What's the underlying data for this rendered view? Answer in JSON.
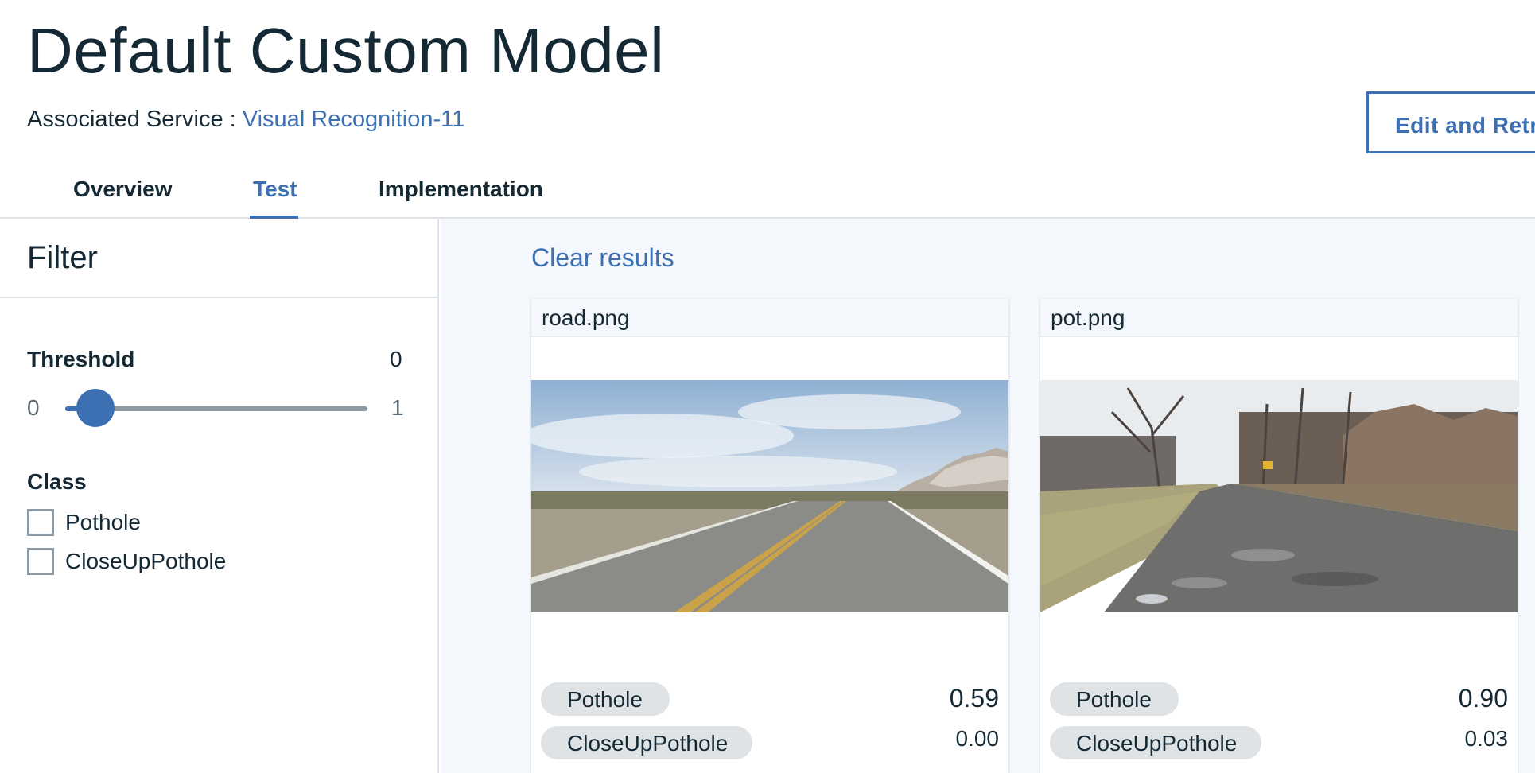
{
  "header": {
    "title": "Default Custom Model",
    "associated_label": "Associated Service : ",
    "associated_link": "Visual Recognition-11",
    "edit_button": "Edit and Retrain"
  },
  "tabs": [
    {
      "label": "Overview",
      "active": false
    },
    {
      "label": "Test",
      "active": true
    },
    {
      "label": "Implementation",
      "active": false
    }
  ],
  "filter": {
    "title": "Filter",
    "threshold_label": "Threshold",
    "threshold_value": "0",
    "slider_min": "0",
    "slider_max": "1",
    "slider_level": 0,
    "class_label": "Class",
    "classes": [
      "Pothole",
      "CloseUpPothole"
    ]
  },
  "main": {
    "clear_results": "Clear results",
    "results": [
      {
        "filename": "road.png",
        "image_icon": "desert-road-photo",
        "classes": [
          {
            "label": "Pothole",
            "score": "0.59"
          },
          {
            "label": "CloseUpPothole",
            "score": "0.00"
          }
        ]
      },
      {
        "filename": "pot.png",
        "image_icon": "pothole-road-photo",
        "classes": [
          {
            "label": "Pothole",
            "score": "0.90"
          },
          {
            "label": "CloseUpPothole",
            "score": "0.03"
          }
        ]
      }
    ]
  },
  "colors": {
    "accent": "#3d70b2",
    "text": "#152935",
    "tag_bg": "#dfe3e6",
    "panel_bg": "#f4f7fb"
  }
}
